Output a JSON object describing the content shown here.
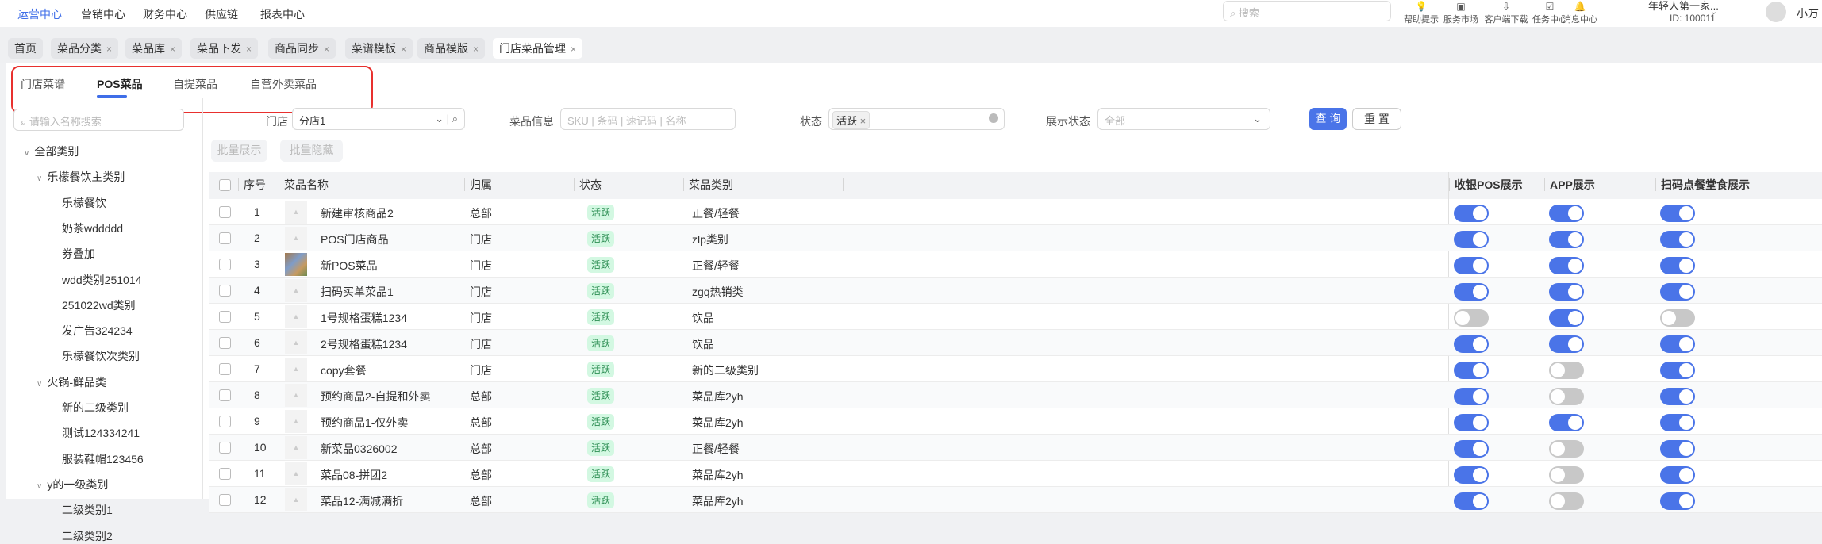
{
  "top_nav": [
    "运营中心",
    "营销中心",
    "财务中心",
    "供应链",
    "报表中心"
  ],
  "search_placeholder": "搜索",
  "tools": [
    "帮助提示",
    "服务市场",
    "客户端下载",
    "任务中心",
    "消息中心"
  ],
  "account": {
    "name": "年轻人第一家...",
    "id": "ID: 100011",
    "user": "小万"
  },
  "tabs": [
    "首页",
    "菜品分类",
    "菜品库",
    "菜品下发",
    "商品同步",
    "菜谱模板",
    "商品模版",
    "门店菜品管理"
  ],
  "subtabs": [
    "门店菜谱",
    "POS菜品",
    "自提菜品",
    "自营外卖菜品"
  ],
  "sidebar": {
    "search_placeholder": "请输入名称搜索",
    "tree": [
      {
        "label": "全部类别",
        "level": 0,
        "exp": true
      },
      {
        "label": "乐檬餐饮主类别",
        "level": 1,
        "exp": true
      },
      {
        "label": "乐檬餐饮",
        "level": 2
      },
      {
        "label": "奶茶wddddd",
        "level": 2
      },
      {
        "label": "券叠加",
        "level": 2
      },
      {
        "label": "wdd类别251014",
        "level": 2
      },
      {
        "label": "251022wd类别",
        "level": 2
      },
      {
        "label": "发广告324234",
        "level": 2
      },
      {
        "label": "乐檬餐饮次类别",
        "level": 2
      },
      {
        "label": "火锅-鲜品类",
        "level": 1,
        "exp": true
      },
      {
        "label": "新的二级类别",
        "level": 2
      },
      {
        "label": "测试124334241",
        "level": 2
      },
      {
        "label": "服装鞋帽123456",
        "level": 2
      },
      {
        "label": "y的一级类别",
        "level": 1,
        "exp": true
      },
      {
        "label": "二级类别1",
        "level": 2
      },
      {
        "label": "二级类别2",
        "level": 2
      }
    ]
  },
  "filters": {
    "store_label": "门店",
    "store_value": "分店1",
    "info_label": "菜品信息",
    "info_placeholder": "SKU | 条码 | 速记码 | 名称",
    "status_label": "状态",
    "status_tag": "活跃",
    "display_label": "展示状态",
    "display_placeholder": "全部",
    "query": "查 询",
    "reset": "重 置"
  },
  "batch": [
    "批量展示",
    "批量隐藏"
  ],
  "columns": [
    "序号",
    "菜品名称",
    "归属",
    "状态",
    "菜品类别",
    "收银POS展示",
    "APP展示",
    "扫码点餐堂食展示"
  ],
  "rows": [
    {
      "no": "1",
      "name": "新建审核商品2",
      "owner": "总部",
      "status": "活跃",
      "cat": "正餐/轻餐",
      "pos": true,
      "app": true,
      "scan": true
    },
    {
      "no": "2",
      "name": "POS门店商品",
      "owner": "门店",
      "status": "活跃",
      "cat": "zlp类别",
      "pos": true,
      "app": true,
      "scan": true
    },
    {
      "no": "3",
      "name": "新POS菜品",
      "owner": "门店",
      "status": "活跃",
      "cat": "正餐/轻餐",
      "pos": true,
      "app": true,
      "scan": true,
      "img": true
    },
    {
      "no": "4",
      "name": "扫码买单菜品1",
      "owner": "门店",
      "status": "活跃",
      "cat": "zgq热销类",
      "pos": true,
      "app": true,
      "scan": true
    },
    {
      "no": "5",
      "name": "1号规格蛋糕1234",
      "owner": "门店",
      "status": "活跃",
      "cat": "饮品",
      "pos": false,
      "app": true,
      "scan": false
    },
    {
      "no": "6",
      "name": "2号规格蛋糕1234",
      "owner": "门店",
      "status": "活跃",
      "cat": "饮品",
      "pos": true,
      "app": true,
      "scan": true
    },
    {
      "no": "7",
      "name": "copy套餐",
      "owner": "门店",
      "status": "活跃",
      "cat": "新的二级类别",
      "pos": true,
      "app": false,
      "scan": true
    },
    {
      "no": "8",
      "name": "预约商品2-自提和外卖",
      "owner": "总部",
      "status": "活跃",
      "cat": "菜品库2yh",
      "pos": true,
      "app": false,
      "scan": true
    },
    {
      "no": "9",
      "name": "预约商品1-仅外卖",
      "owner": "总部",
      "status": "活跃",
      "cat": "菜品库2yh",
      "pos": true,
      "app": true,
      "scan": true
    },
    {
      "no": "10",
      "name": "新菜品0326002",
      "owner": "总部",
      "status": "活跃",
      "cat": "正餐/轻餐",
      "pos": true,
      "app": false,
      "scan": true
    },
    {
      "no": "11",
      "name": "菜品08-拼团2",
      "owner": "总部",
      "status": "活跃",
      "cat": "菜品库2yh",
      "pos": true,
      "app": false,
      "scan": true
    },
    {
      "no": "12",
      "name": "菜品12-满减满折",
      "owner": "总部",
      "status": "活跃",
      "cat": "菜品库2yh",
      "pos": true,
      "app": false,
      "scan": true
    }
  ]
}
